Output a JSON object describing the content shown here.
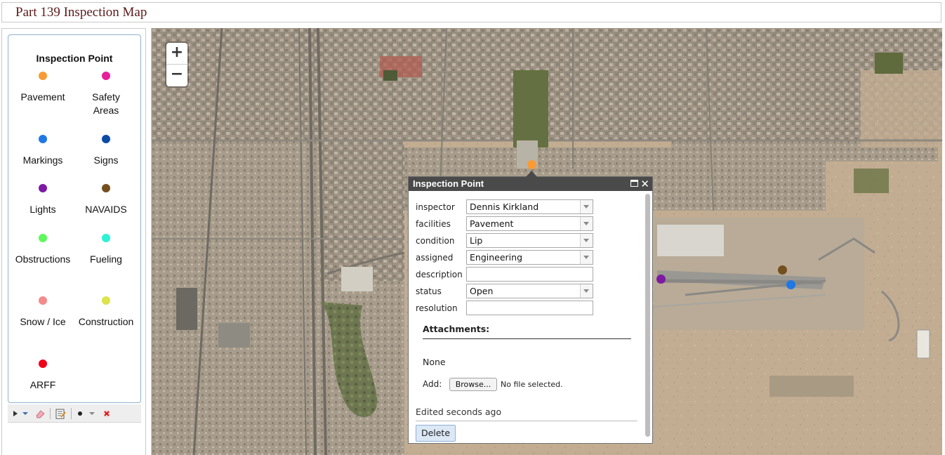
{
  "header": {
    "title": "Part 139 Inspection Map"
  },
  "legend": {
    "title": "Inspection Point",
    "items": [
      {
        "label": "Pavement",
        "color": "#f99b34"
      },
      {
        "label": "Safety Areas",
        "color": "#e61f9c"
      },
      {
        "label": "Markings",
        "color": "#1f78e5"
      },
      {
        "label": "Signs",
        "color": "#0b4aa5"
      },
      {
        "label": "Lights",
        "color": "#7d1aa3"
      },
      {
        "label": "NAVAIDS",
        "color": "#74501f"
      },
      {
        "label": "Obstructions",
        "color": "#5ef85c"
      },
      {
        "label": "Fueling",
        "color": "#2bf3d4"
      },
      {
        "label": "Snow / Ice",
        "color": "#f48b8b"
      },
      {
        "label": "Construction",
        "color": "#dce34b"
      },
      {
        "label": "ARFF",
        "color": "#f0001b"
      }
    ]
  },
  "toolbar": {
    "icons": [
      "select-arrow-icon",
      "dropdown-arrow-icon",
      "eraser-icon",
      "edit-attributes-icon",
      "point-tool-icon",
      "dropdown-arrow-icon",
      "delete-icon"
    ]
  },
  "map": {
    "zoom_in": "+",
    "zoom_out": "−",
    "markers": [
      {
        "category": "Pavement",
        "color": "#f99b34"
      },
      {
        "category": "Lights",
        "color": "#7d1aa3"
      },
      {
        "category": "NAVAIDS",
        "color": "#74501f"
      },
      {
        "category": "Markings",
        "color": "#1f78e5"
      }
    ]
  },
  "popup": {
    "title": "Inspection Point",
    "fields": [
      {
        "label": "inspector",
        "value": "Dennis Kirkland",
        "type": "select"
      },
      {
        "label": "facilities",
        "value": "Pavement",
        "type": "select"
      },
      {
        "label": "condition",
        "value": "Lip",
        "type": "select"
      },
      {
        "label": "assigned",
        "value": "Engineering",
        "type": "select"
      },
      {
        "label": "description",
        "value": "",
        "type": "text"
      },
      {
        "label": "status",
        "value": "Open",
        "type": "select"
      },
      {
        "label": "resolution",
        "value": "",
        "type": "text"
      }
    ],
    "attachments_title": "Attachments:",
    "attachments_value": "None",
    "add_label": "Add:",
    "browse_label": "Browse...",
    "no_file_text": "No file selected.",
    "edited_text": "Edited seconds ago",
    "delete_label": "Delete"
  }
}
